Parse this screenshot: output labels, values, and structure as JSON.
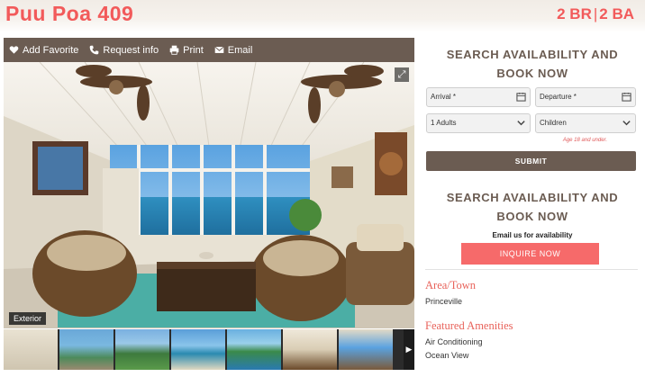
{
  "header": {
    "title": "Puu Poa 409",
    "bedrooms": "2 BR",
    "baths": "2 BA"
  },
  "toolbar": {
    "add_favorite": "Add Favorite",
    "request_info": "Request info",
    "print": "Print",
    "email": "Email"
  },
  "gallery": {
    "caption": "Exterior",
    "thumbnail_count": 7
  },
  "sidebar": {
    "search_title_line1": "SEARCH AVAILABILITY AND",
    "search_title_line2": "BOOK NOW",
    "arrival_placeholder": "Arrival *",
    "departure_placeholder": "Departure *",
    "adults_value": "1 Adults",
    "children_placeholder": "Children",
    "age_note": "Age 18 and under.",
    "submit_label": "SUBMIT",
    "inquire_title_line1": "SEARCH AVAILABILITY AND",
    "inquire_title_line2": "BOOK NOW",
    "email_note": "Email us for availability",
    "inquire_label": "INQUIRE NOW",
    "area_title": "Area/Town",
    "area_value": "Princeville",
    "amenities_title": "Featured Amenities",
    "amenities": [
      "Air Conditioning",
      "Ocean View"
    ]
  },
  "colors": {
    "accent": "#f25a5a",
    "toolbar": "#6b5c52",
    "button": "#f66a6a"
  }
}
